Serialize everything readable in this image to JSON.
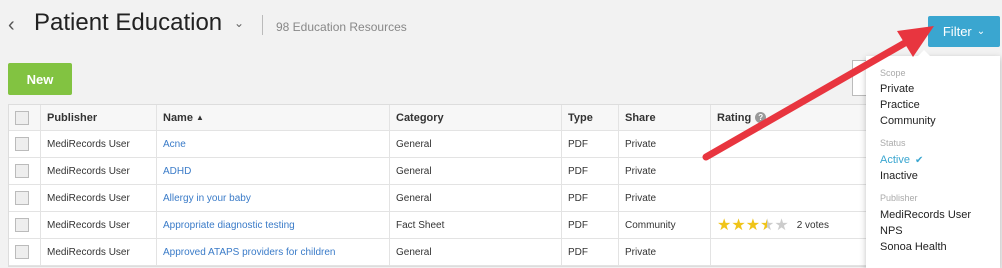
{
  "header": {
    "title": "Patient Education",
    "subtitle": "98 Education Resources",
    "back_glyph": "‹",
    "caret_glyph": "⌄"
  },
  "toolbar": {
    "new_label": "New",
    "filter_label": "Filter",
    "filter_chev": "⌄"
  },
  "table": {
    "columns": [
      "Publisher",
      "Name",
      "Category",
      "Type",
      "Share",
      "Rating"
    ],
    "sort_arrow": "▲",
    "help_glyph": "?",
    "rows": [
      {
        "publisher": "MediRecords User",
        "name": "Acne",
        "category": "General",
        "type": "PDF",
        "share": "Private"
      },
      {
        "publisher": "MediRecords User",
        "name": "ADHD",
        "category": "General",
        "type": "PDF",
        "share": "Private"
      },
      {
        "publisher": "MediRecords User",
        "name": "Allergy in your baby",
        "category": "General",
        "type": "PDF",
        "share": "Private"
      },
      {
        "publisher": "MediRecords User",
        "name": "Appropriate diagnostic testing",
        "category": "Fact Sheet",
        "type": "PDF",
        "share": "Community",
        "rating": 3.5,
        "votes": "2 votes"
      },
      {
        "publisher": "MediRecords User",
        "name": "Approved ATAPS providers for children",
        "category": "General",
        "type": "PDF",
        "share": "Private"
      }
    ]
  },
  "filter_menu": {
    "scope_label": "Scope",
    "scope_items": [
      "Private",
      "Practice",
      "Community"
    ],
    "status_label": "Status",
    "status_items": [
      "Active",
      "Inactive"
    ],
    "status_active_check": "✔",
    "publisher_label": "Publisher",
    "publisher_items": [
      "MediRecords User",
      "NPS",
      "Sonoa Health"
    ]
  },
  "colors": {
    "filter_button": "#3aa6d0",
    "new_button": "#82c341",
    "arrow": "#e8353f",
    "link": "#3a7bc8",
    "star": "#f0c419"
  }
}
